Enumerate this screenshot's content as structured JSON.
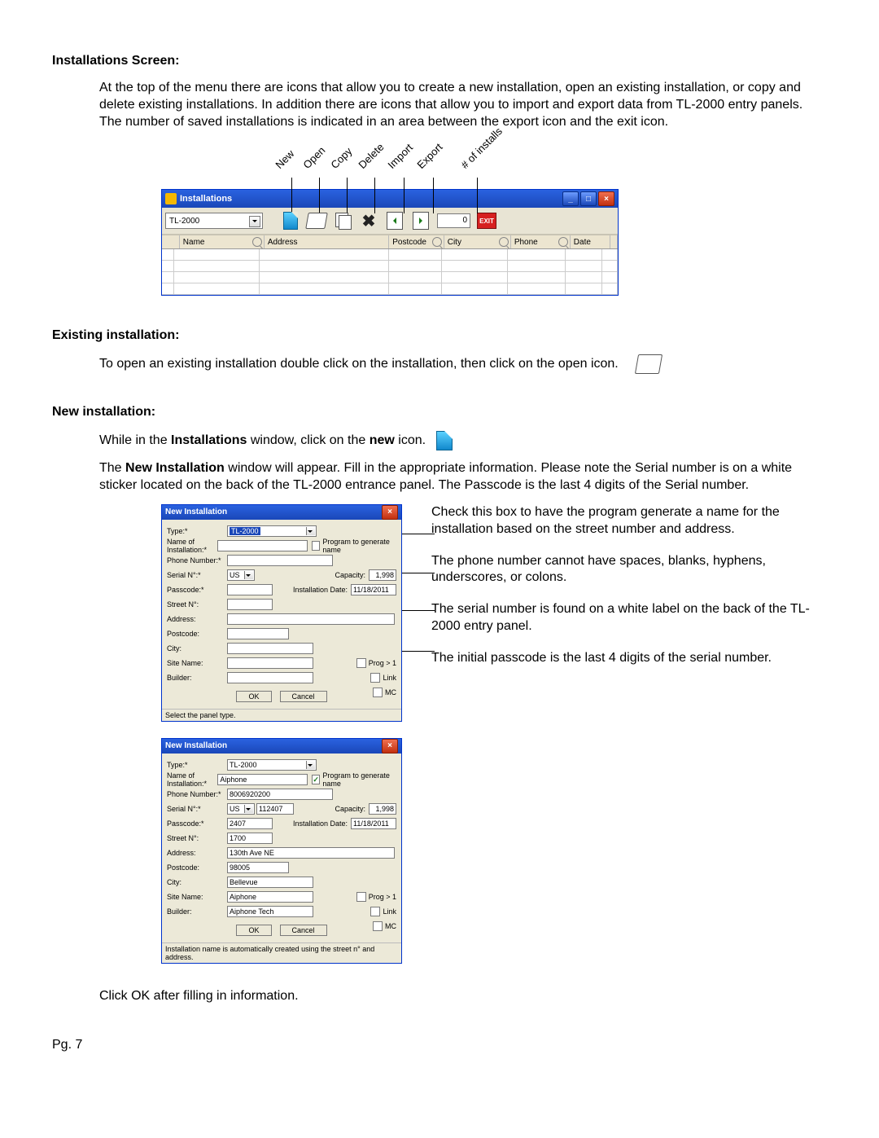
{
  "sections": {
    "installations": {
      "title": "Installations Screen:",
      "body": "At the top of the menu there are icons that allow you to create a new installation, open an existing installation, or copy and delete existing installations.  In addition there are icons that allow you to import and export data from TL-2000 entry panels.  The number of saved installations is indicated in an area between the export icon and the exit icon."
    },
    "existing": {
      "title": "Existing installation:",
      "body": "To open an existing installation double click on the installation, then click on the open icon."
    },
    "newinst": {
      "title": "New installation:",
      "body1a": "While in the ",
      "body1b": "Installations",
      "body1c": " window, click on the ",
      "body1d": "new",
      "body1e": " icon.",
      "body2a": "The ",
      "body2b": "New Installation",
      "body2c": " window will appear.  Fill in the appropriate information.  Please note the Serial number is on a white sticker located on the back of the TL-2000 entrance panel.  The Passcode is the last 4 digits of the Serial number."
    },
    "bottom_note": "Click OK after filling in information."
  },
  "toolbar_labels": [
    "New",
    "Open",
    "Copy",
    "Delete",
    "Import",
    "Export",
    "# of installs"
  ],
  "installations_window": {
    "title": "Installations",
    "dropdown": "TL-2000",
    "count": "0",
    "exit": "EXIT",
    "columns": [
      "Name",
      "Address",
      "Postcode",
      "City",
      "Phone",
      "Date"
    ]
  },
  "dlg_labels": {
    "title": "New Installation",
    "type": "Type:*",
    "name": "Name of Installation:*",
    "program_gen": "Program to generate name",
    "phone": "Phone Number:*",
    "serial": "Serial N°:*",
    "capacity": "Capacity:",
    "passcode": "Passcode:*",
    "install_date": "Installation Date:",
    "street": "Street N°:",
    "address": "Address:",
    "postcode": "Postcode:",
    "city": "City:",
    "sitename": "Site Name:",
    "builder": "Builder:",
    "prog": "Prog > 1",
    "link": "Link",
    "mc": "MC",
    "ok": "OK",
    "cancel": "Cancel"
  },
  "dlg1": {
    "type": "TL-2000",
    "name": "",
    "program_gen": false,
    "phone": "",
    "serial_prefix": "US",
    "serial_num": "",
    "capacity": "1,998",
    "passcode": "",
    "install_date": "11/18/2011",
    "street": "",
    "address": "",
    "postcode": "",
    "city": "",
    "sitename": "",
    "builder": "",
    "status": "Select the panel type."
  },
  "dlg2": {
    "type": "TL-2000",
    "name": "Aiphone",
    "program_gen": true,
    "phone": "8006920200",
    "serial_prefix": "US",
    "serial_num": "112407",
    "capacity": "1,998",
    "passcode": "2407",
    "install_date": "11/18/2011",
    "street": "1700",
    "address": "130th Ave NE",
    "postcode": "98005",
    "city": "Bellevue",
    "sitename": "Aiphone",
    "builder": "Aiphone Tech",
    "status": "Installation name is automatically created using the street n° and address."
  },
  "callouts": {
    "c1": "Check this box to have the program generate a name for the installation based on the street number and address.",
    "c2": "The phone number cannot have spaces, blanks, hyphens, underscores, or colons.",
    "c3": "The serial number is found on a white label on the back of the TL-2000 entry panel.",
    "c4": "The initial passcode is the last 4 digits of the serial number."
  },
  "page_number": "Pg. 7"
}
